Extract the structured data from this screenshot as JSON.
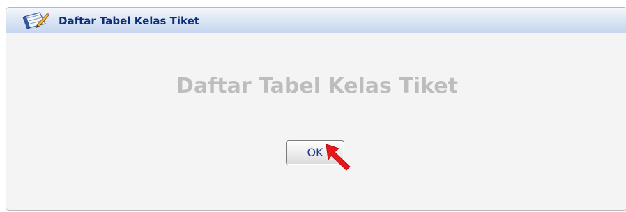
{
  "dialog": {
    "title": "Daftar Tabel Kelas Tiket",
    "title_icon": "notepad-pencil-icon",
    "heading": "Daftar Tabel Kelas Tiket",
    "ok_label": "OK"
  },
  "cursor": {
    "icon": "red-arrow-cursor-icon",
    "color": "#e8151b"
  },
  "colors": {
    "title_text": "#0f2e7a",
    "heading_text": "#bdbdbd",
    "button_text": "#213c8a"
  }
}
